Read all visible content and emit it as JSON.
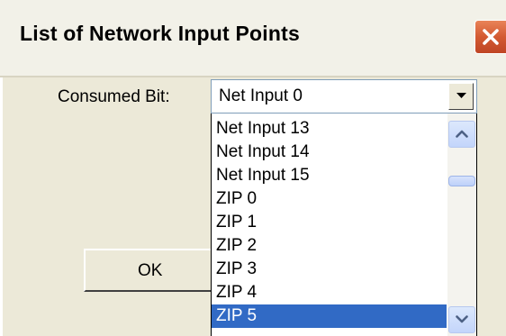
{
  "window": {
    "title": "List of Network Input Points",
    "close_icon": "close-x-icon"
  },
  "form": {
    "consumed_label": "Consumed Bit:",
    "selected_value": "Net Input 0",
    "ok_label": "OK"
  },
  "dropdown": {
    "items": [
      "Net Input 13",
      "Net Input 14",
      "Net Input 15",
      "ZIP 0",
      "ZIP 1",
      "ZIP 2",
      "ZIP 3",
      "ZIP 4",
      "ZIP 5"
    ],
    "highlighted": "ZIP 5"
  },
  "colors": {
    "highlight": "#316ac5",
    "close_button": "#d35a32",
    "dialog_face": "#ece9d8"
  }
}
